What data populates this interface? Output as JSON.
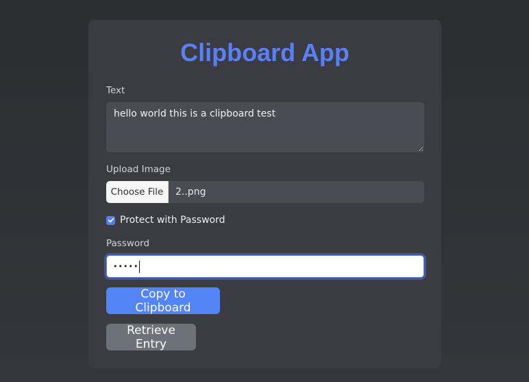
{
  "app": {
    "title": "Clipboard App"
  },
  "text_field": {
    "label": "Text",
    "value": "hello world this is a clipboard test"
  },
  "upload": {
    "label": "Upload Image",
    "button_label": "Choose File",
    "file_name": "2..png"
  },
  "protect": {
    "label": "Protect with Password",
    "checked": true
  },
  "password": {
    "label": "Password",
    "masked_value": "•••••"
  },
  "actions": {
    "copy_label": "Copy to Clipboard",
    "retrieve_label": "Retrieve Entry"
  },
  "colors": {
    "accent": "#5b7ff5",
    "primary_button": "#5385f6",
    "secondary_button": "#6d7278",
    "card_bg": "#3a3c42"
  },
  "icons": {
    "checkbox": "checkmark-icon",
    "resize": "resize-grip-icon"
  }
}
